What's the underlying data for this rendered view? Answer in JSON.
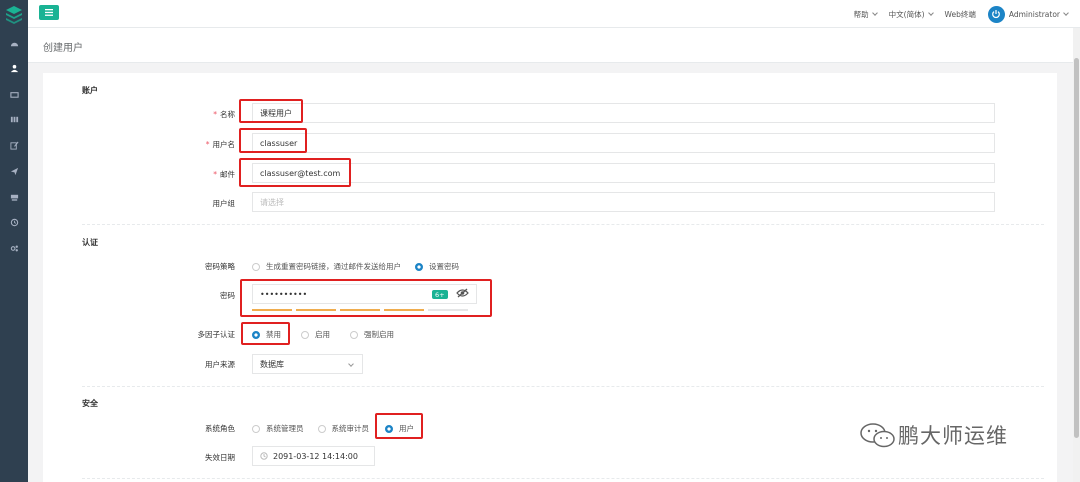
{
  "topbar": {
    "help": "帮助",
    "language": "中文(简体)",
    "web_terminal": "Web终端",
    "user": "Administrator"
  },
  "page": {
    "title": "创建用户"
  },
  "account": {
    "section": "账户",
    "name_label": "名称",
    "name_value": "课程用户",
    "username_label": "用户名",
    "username_value": "classuser",
    "email_label": "邮件",
    "email_value": "classuser@test.com",
    "group_label": "用户组",
    "group_placeholder": "请选择"
  },
  "auth": {
    "section": "认证",
    "pw_strategy_label": "密码策略",
    "pw_strategy_options": [
      "生成重置密码链接，通过邮件发送给用户",
      "设置密码"
    ],
    "pw_strategy_selected": 1,
    "password_label": "密码",
    "password_value": "••••••••••",
    "password_badge": "6+",
    "strength_colors": [
      "#f0ad4e",
      "#f0ad4e",
      "#f0ad4e",
      "#f0ad4e",
      "#e5e6e7"
    ],
    "mfa_label": "多因子认证",
    "mfa_options": [
      "禁用",
      "启用",
      "强制启用"
    ],
    "mfa_selected": 0,
    "source_label": "用户来源",
    "source_value": "数据库"
  },
  "security": {
    "section": "安全",
    "role_label": "系统角色",
    "role_options": [
      "系统管理员",
      "系统审计员",
      "用户"
    ],
    "role_selected": 2,
    "expire_label": "失效日期",
    "expire_value": "2091-03-12 14:14:00"
  },
  "watermark": {
    "text": "鹏大师运维"
  },
  "colors": {
    "sidebar": "#2f4050",
    "accent": "#1ab394",
    "primary": "#1c84c6",
    "highlight": "#e02020"
  }
}
